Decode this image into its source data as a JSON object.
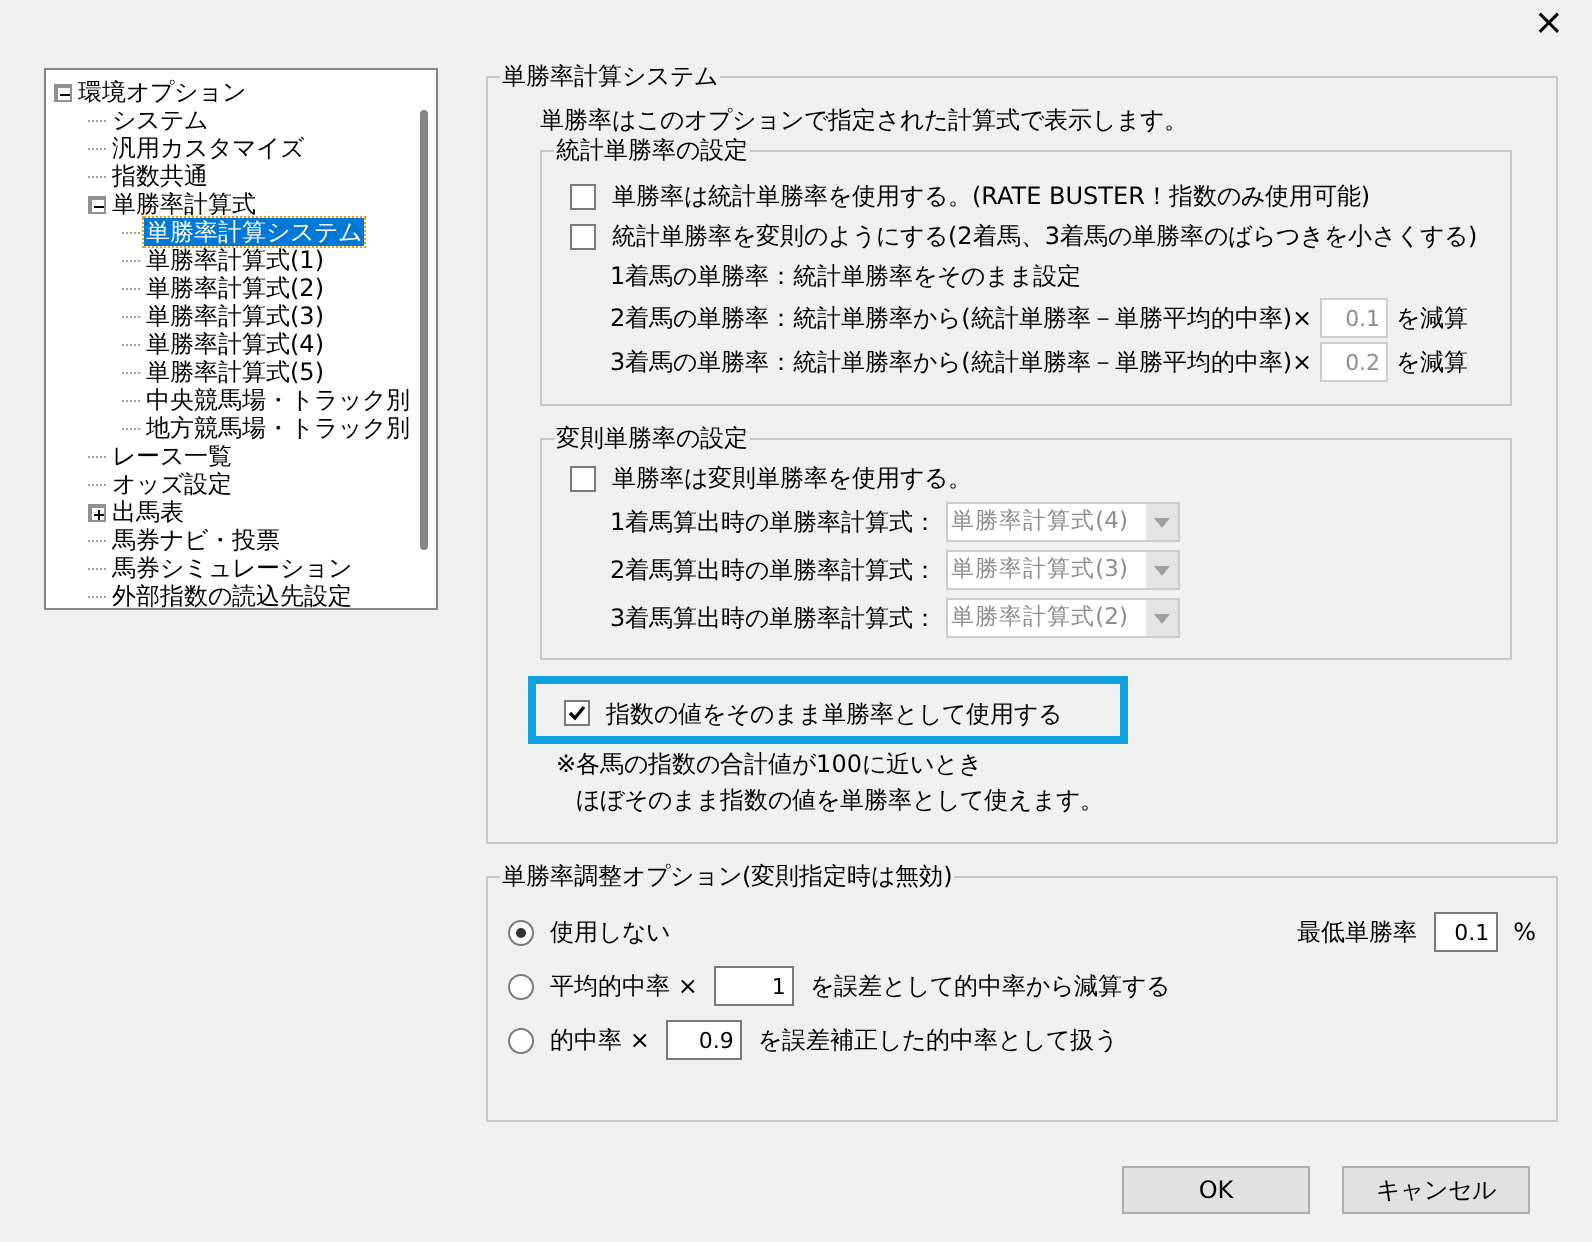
{
  "close_button": "×",
  "tree": [
    {
      "label": "環境オプション",
      "expanded": true,
      "selected": false,
      "children": [
        {
          "label": "システム",
          "selected": false
        },
        {
          "label": "汎用カスタマイズ",
          "selected": false
        },
        {
          "label": "指数共通",
          "selected": false
        },
        {
          "label": "単勝率計算式",
          "expanded": true,
          "selected": false,
          "children": [
            {
              "label": "単勝率計算システム",
              "selected": true
            },
            {
              "label": "単勝率計算式(1)",
              "selected": false
            },
            {
              "label": "単勝率計算式(2)",
              "selected": false
            },
            {
              "label": "単勝率計算式(3)",
              "selected": false
            },
            {
              "label": "単勝率計算式(4)",
              "selected": false
            },
            {
              "label": "単勝率計算式(5)",
              "selected": false
            },
            {
              "label": "中央競馬場・トラック別",
              "selected": false
            },
            {
              "label": "地方競馬場・トラック別",
              "selected": false
            }
          ]
        },
        {
          "label": "レース一覧",
          "selected": false
        },
        {
          "label": "オッズ設定",
          "selected": false
        },
        {
          "label": "出馬表",
          "expanded": false,
          "selected": false
        },
        {
          "label": "馬券ナビ・投票",
          "selected": false
        },
        {
          "label": "馬券シミュレーション",
          "selected": false
        },
        {
          "label": "外部指数の読込先設定",
          "selected": false
        }
      ]
    }
  ],
  "system_group": {
    "title": "単勝率計算システム",
    "description": "単勝率はこのオプションで指定された計算式で表示します。",
    "stat_group": {
      "title": "統計単勝率の設定",
      "rows": [
        {
          "kind": "check",
          "label": "単勝率は統計単勝率を使用する。(RATE BUSTER！指数のみ使用可能)",
          "checked": false
        },
        {
          "kind": "check",
          "label": "統計単勝率を変則のようにする(2着馬、3着馬の単勝率のばらつきを小さくする)",
          "checked": false
        },
        {
          "kind": "text",
          "label": "1着馬の単勝率：統計単勝率をそのまま設定"
        },
        {
          "kind": "input",
          "label": "2着馬の単勝率：統計単勝率から(統計単勝率－単勝平均的中率)×",
          "value": "0.1",
          "suffix": "を減算",
          "disabled": true
        },
        {
          "kind": "input",
          "label": "3着馬の単勝率：統計単勝率から(統計単勝率－単勝平均的中率)×",
          "value": "0.2",
          "suffix": "を減算",
          "disabled": true
        }
      ]
    },
    "irregular_group": {
      "title": "変則単勝率の設定",
      "check": {
        "label": "単勝率は変則単勝率を使用する。",
        "checked": false
      },
      "combos": [
        {
          "label": "1着馬算出時の単勝率計算式：",
          "value": "単勝率計算式(4)",
          "disabled": true
        },
        {
          "label": "2着馬算出時の単勝率計算式：",
          "value": "単勝率計算式(3)",
          "disabled": true
        },
        {
          "label": "3着馬算出時の単勝率計算式：",
          "value": "単勝率計算式(2)",
          "disabled": true
        }
      ]
    },
    "index_check": {
      "label": "指数の値をそのまま単勝率として使用する",
      "checked": true,
      "highlighted": true
    },
    "notes": [
      "※各馬の指数の合計値が100に近いとき",
      "ほぼそのまま指数の値を単勝率として使えます。"
    ]
  },
  "adjust_group": {
    "title": "単勝率調整オプション(変則指定時は無効)",
    "options": [
      {
        "parts": [
          "使用しない"
        ],
        "selected": true
      },
      {
        "parts": [
          "平均的中率 ×",
          "を誤差として的中率から減算する"
        ],
        "value": "1",
        "selected": false
      },
      {
        "parts": [
          "的中率 ×",
          "を誤差補正した的中率として扱う"
        ],
        "value": "0.9",
        "selected": false
      }
    ],
    "min_rate": {
      "label": "最低単勝率",
      "value": "0.1",
      "unit": "%"
    }
  },
  "buttons": [
    "OK",
    "キャンセル"
  ]
}
